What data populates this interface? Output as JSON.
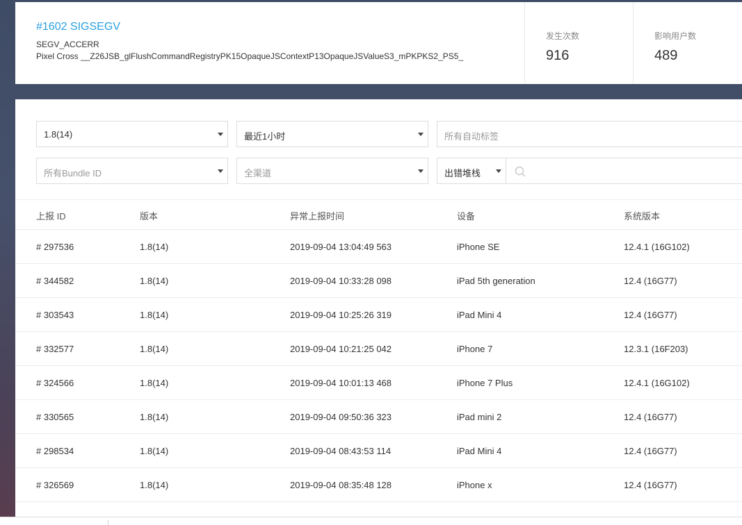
{
  "issue": {
    "title": "#1602 SIGSEGV",
    "type": "SEGV_ACCERR",
    "symbol": "Pixel Cross __Z26JSB_glFlushCommandRegistryPK15OpaqueJSContextP13OpaqueJSValueS3_mPKPKS2_PS5_"
  },
  "stats": {
    "occurrences": {
      "label": "发生次数",
      "value": "916"
    },
    "affected_users": {
      "label": "影响用户数",
      "value": "489"
    }
  },
  "filters": {
    "version": "1.8(14)",
    "time_range": "最近1小时",
    "tags_placeholder": "所有自动标签",
    "bundle_placeholder": "所有Bundle ID",
    "channel_placeholder": "全渠道",
    "search_type": "出错堆栈",
    "search_value": ""
  },
  "table": {
    "headers": {
      "report_id": "上报 ID",
      "version": "版本",
      "time": "异常上报时间",
      "device": "设备",
      "os": "系统版本"
    },
    "rows": [
      {
        "id": "# 297536",
        "version": "1.8(14)",
        "time": "2019-09-04 13:04:49 563",
        "device": "iPhone SE",
        "os": "12.4.1 (16G102)"
      },
      {
        "id": "# 344582",
        "version": "1.8(14)",
        "time": "2019-09-04 10:33:28 098",
        "device": "iPad 5th generation",
        "os": "12.4 (16G77)"
      },
      {
        "id": "# 303543",
        "version": "1.8(14)",
        "time": "2019-09-04 10:25:26 319",
        "device": "iPad Mini 4",
        "os": "12.4 (16G77)"
      },
      {
        "id": "# 332577",
        "version": "1.8(14)",
        "time": "2019-09-04 10:21:25 042",
        "device": "iPhone 7",
        "os": "12.3.1 (16F203)"
      },
      {
        "id": "# 324566",
        "version": "1.8(14)",
        "time": "2019-09-04 10:01:13 468",
        "device": "iPhone 7 Plus",
        "os": "12.4.1 (16G102)"
      },
      {
        "id": "# 330565",
        "version": "1.8(14)",
        "time": "2019-09-04 09:50:36 323",
        "device": "iPad mini 2",
        "os": "12.4 (16G77)"
      },
      {
        "id": "# 298534",
        "version": "1.8(14)",
        "time": "2019-09-04 08:43:53 114",
        "device": "iPad Mini 4",
        "os": "12.4 (16G77)"
      },
      {
        "id": "# 326569",
        "version": "1.8(14)",
        "time": "2019-09-04 08:35:48 128",
        "device": "iPhone x",
        "os": "12.4 (16G77)"
      }
    ]
  },
  "colors": {
    "accent": "#2a9fe0"
  }
}
